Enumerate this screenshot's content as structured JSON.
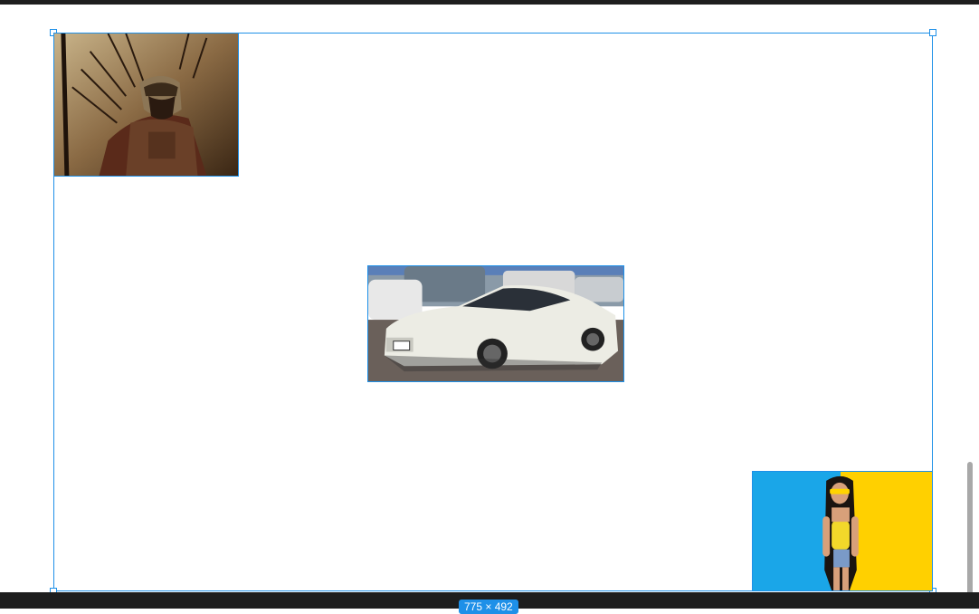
{
  "canvas": {
    "size_label": "775 × 492",
    "accent_color": "#1e90e8",
    "background_color": "#ffffff",
    "chrome_color": "#1e1e1e"
  },
  "images": [
    {
      "name": "spartan-warrior-image",
      "icon": "photo-icon"
    },
    {
      "name": "white-sports-car-image",
      "icon": "photo-icon"
    },
    {
      "name": "woman-yellow-sunglasses-image",
      "icon": "photo-icon"
    }
  ]
}
